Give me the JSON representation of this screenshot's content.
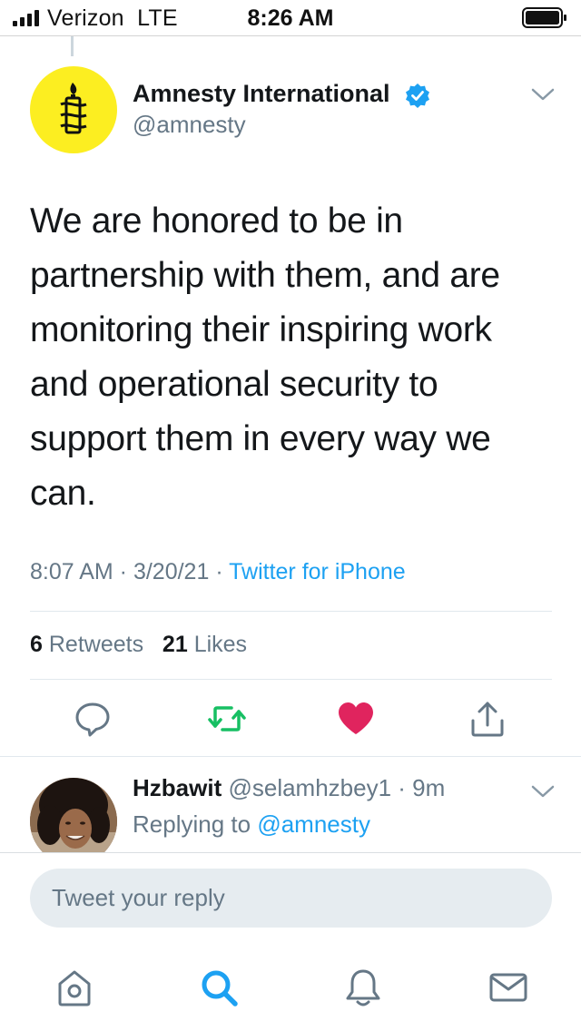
{
  "status_bar": {
    "carrier": "Verizon",
    "network": "LTE",
    "time": "8:26 AM"
  },
  "tweet": {
    "author_name": "Amnesty International",
    "author_handle": "@amnesty",
    "verified": true,
    "text": "We are honored to be in partnership with them, and are monitoring their inspiring work and operational security to support them in every way we can.",
    "time": "8:07 AM",
    "date": "3/20/21",
    "source": "Twitter for iPhone",
    "retweet_count": "6",
    "retweet_label": "Retweets",
    "like_count": "21",
    "like_label": "Likes",
    "liked": true
  },
  "actions": [
    {
      "icon": "reply-icon"
    },
    {
      "icon": "retweet-icon"
    },
    {
      "icon": "heart-icon"
    },
    {
      "icon": "share-icon"
    }
  ],
  "reply": {
    "author_name": "Hzbawit",
    "author_handle": "@selamhzbey1",
    "age": "9m",
    "replying_label": "Replying to",
    "replying_to": "@amnesty"
  },
  "composer": {
    "placeholder": "Tweet your reply"
  },
  "tab_bar": [
    {
      "icon": "home-icon"
    },
    {
      "icon": "search-icon",
      "active": true
    },
    {
      "icon": "bell-icon"
    },
    {
      "icon": "mail-icon"
    }
  ],
  "colors": {
    "accent": "#1da1f2",
    "retweet": "#17bf63",
    "like": "#e0245e",
    "secondary_text": "#657786",
    "avatar_bg": "#fcee21"
  }
}
